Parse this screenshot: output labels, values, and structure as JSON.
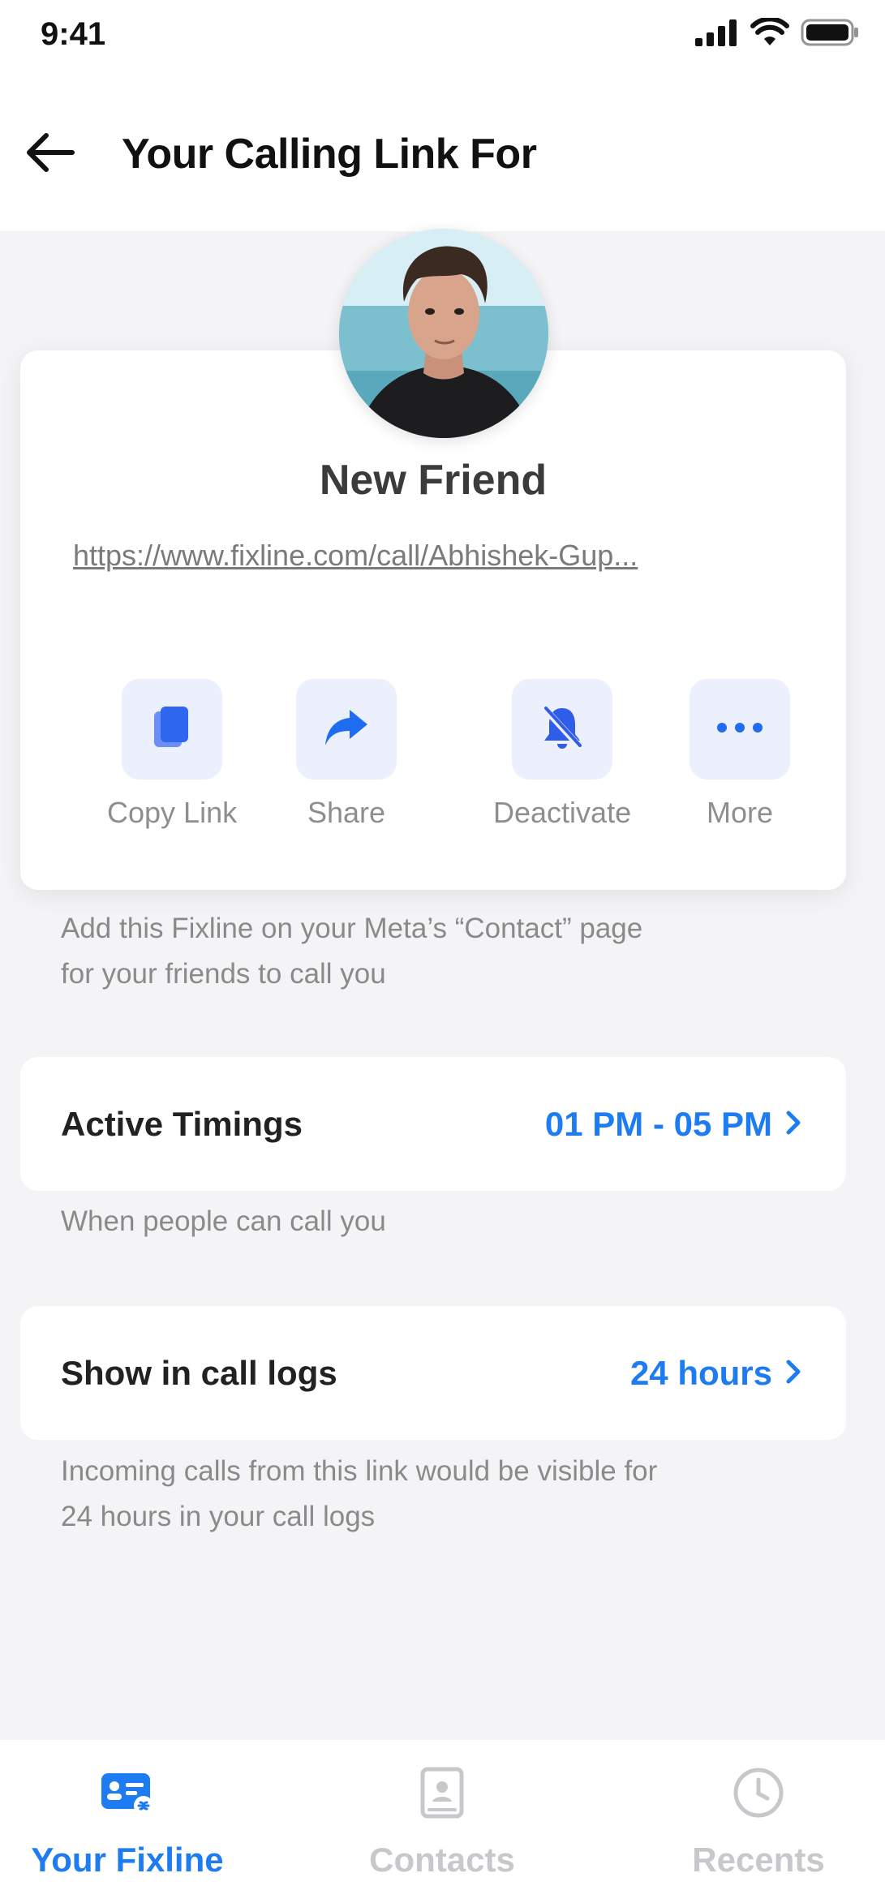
{
  "status_bar": {
    "time": "9:41"
  },
  "header": {
    "title": "Your Calling Link For"
  },
  "profile": {
    "name": "New Friend",
    "link": "https://www.fixline.com/call/Abhishek-Gup..."
  },
  "actions": [
    {
      "label": "Copy Link",
      "icon": "copy-icon"
    },
    {
      "label": "Share",
      "icon": "share-icon"
    },
    {
      "label": "Deactivate",
      "icon": "bell-off-icon"
    },
    {
      "label": "More",
      "icon": "more-icon"
    }
  ],
  "info": {
    "meta_note_line1": "Add this Fixline on your Meta’s “Contact” page",
    "meta_note_line2": "for your friends to call you"
  },
  "settings": {
    "active_timings": {
      "label": "Active Timings",
      "value": "01 PM - 05 PM",
      "helper": "When people can call you"
    },
    "call_logs": {
      "label": "Show in call logs",
      "value": "24 hours",
      "helper_line1": "Incoming calls from this link would be visible for",
      "helper_line2": "24 hours in your call logs"
    }
  },
  "bottom_nav": [
    {
      "label": "Your Fixline",
      "icon": "fixline-card-icon",
      "active": true
    },
    {
      "label": "Contacts",
      "icon": "contacts-icon",
      "active": false
    },
    {
      "label": "Recents",
      "icon": "clock-icon",
      "active": false
    }
  ],
  "colors": {
    "accent": "#1e7cf2",
    "inactive": "#c8c8cc",
    "background": "#f4f4f6",
    "tile": "#eceffc"
  }
}
